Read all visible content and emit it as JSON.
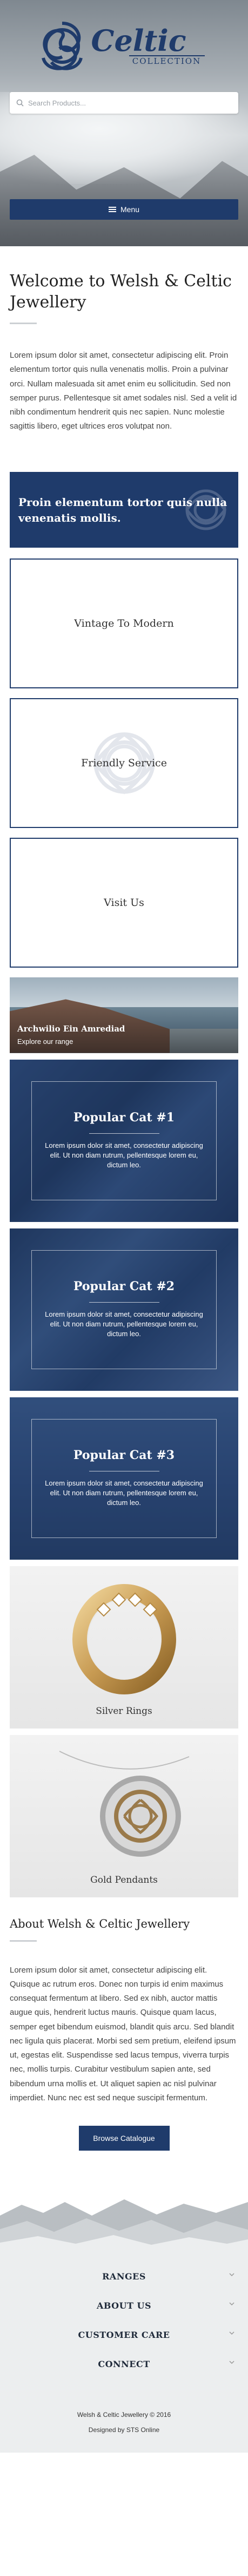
{
  "header": {
    "logo_word": "Celtic",
    "logo_sub": "COLLECTION",
    "search_placeholder": "Search Products...",
    "menu_label": "Menu"
  },
  "welcome": {
    "title": "Welcome to Welsh & Celtic Jewellery",
    "body": "Lorem ipsum dolor sit amet, consectetur adipiscing elit. Proin elementum tortor quis nulla venenatis mollis. Proin a pulvinar orci. Nullam malesuada sit amet enim eu sollicitudin. Sed non semper purus. Pellentesque sit amet sodales nisl. Sed a velit id nibh condimentum hendrerit quis nec sapien. Nunc molestie sagittis libero, eget ultrices eros volutpat non."
  },
  "promo": {
    "title": "Proin elementum tortor quis nulla venenatis mollis."
  },
  "boxes": [
    {
      "label": "Vintage To Modern"
    },
    {
      "label": "Friendly Service"
    },
    {
      "label": "Visit Us"
    }
  ],
  "banner": {
    "title": "Archwilio Ein Amrediad",
    "subtitle": "Explore our range"
  },
  "categories": [
    {
      "title": "Popular Cat #1",
      "text": "Lorem ipsum dolor sit amet, consectetur adipiscing elit. Ut non diam rutrum, pellentesque lorem eu, dictum leo."
    },
    {
      "title": "Popular Cat #2",
      "text": "Lorem ipsum dolor sit amet, consectetur adipiscing elit. Ut non diam rutrum, pellentesque lorem eu, dictum leo."
    },
    {
      "title": "Popular Cat #3",
      "text": "Lorem ipsum dolor sit amet, consectetur adipiscing elit. Ut non diam rutrum, pellentesque lorem eu, dictum leo."
    }
  ],
  "products": [
    {
      "label": "Silver Rings"
    },
    {
      "label": "Gold Pendants"
    }
  ],
  "about": {
    "title": "About Welsh & Celtic Jewellery",
    "body": "Lorem ipsum dolor sit amet, consectetur adipiscing elit. Quisque ac rutrum eros. Donec non turpis id enim maximus consequat fermentum at libero. Sed ex nibh, auctor mattis augue quis, hendrerit luctus mauris. Quisque quam lacus, semper eget bibendum euismod, blandit quis arcu. Sed blandit nec ligula quis placerat. Morbi sed sem pretium, eleifend ipsum ut, egestas elit. Suspendisse sed lacus tempus, viverra turpis nec, mollis turpis. Curabitur vestibulum sapien ante, sed bibendum urna mollis et. Ut aliquet sapien ac nisl pulvinar imperdiet. Nunc nec est sed neque suscipit fermentum.",
    "button_label": "Browse Catalogue"
  },
  "footer": {
    "nav": [
      "RANGES",
      "ABOUT US",
      "CUSTOMER CARE",
      "CONNECT"
    ],
    "copyright": "Welsh & Celtic Jewellery © 2016",
    "credit": "Designed by STS Online"
  },
  "colors": {
    "brand_navy": "#1f3b6b",
    "footer_bg": "#eceeef"
  }
}
